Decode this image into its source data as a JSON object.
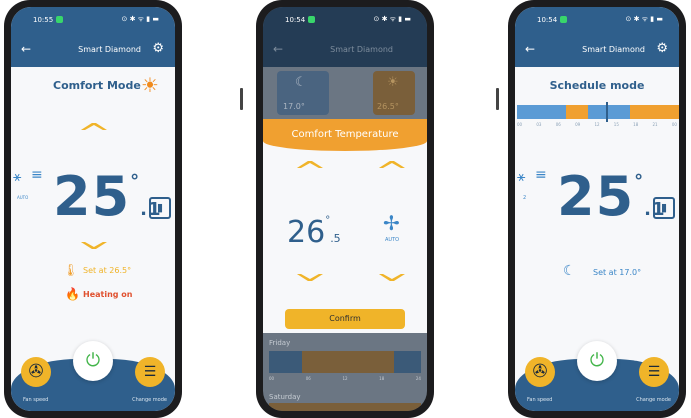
{
  "phone1": {
    "status": {
      "time": "10:55",
      "icons": "⊙ ✱ ᯤ ▮ ▬"
    },
    "header": {
      "back": "←",
      "title": "Smart Diamond"
    },
    "mode_title": "Comfort Mode",
    "fan_label": "AUTO",
    "temp_int": "25",
    "temp_dec": ".1",
    "temp_deg": "°",
    "set_text": "Set at 26.5°",
    "heating_text": "Heating on",
    "bottom": {
      "fan_speed": "Fan speed",
      "change_mode": "Change mode"
    }
  },
  "phone2": {
    "status": {
      "time": "10:54",
      "icons": "⊙ ✱ ᯤ ▮ ▬"
    },
    "header": {
      "back": "←",
      "title": "Smart Diamond"
    },
    "night_temp": "17.0°",
    "comfort_temp": "26.5°",
    "panel_title": "Comfort Temperature",
    "temp_int": "26",
    "temp_dec": ".5",
    "temp_deg": "°",
    "fan_label": "AUTO",
    "confirm_label": "Confirm",
    "day1": "Friday",
    "day2": "Saturday",
    "ticks": [
      "00",
      "06",
      "12",
      "18",
      "24"
    ]
  },
  "phone3": {
    "status": {
      "time": "10:54",
      "icons": "⊙ ✱ ᯤ ▮ ▬"
    },
    "header": {
      "back": "←",
      "title": "Smart Diamond"
    },
    "mode_title": "Schedule mode",
    "ticks": [
      "00",
      "03",
      "06",
      "09",
      "12",
      "15",
      "18",
      "21",
      "00"
    ],
    "fan_label": "2",
    "temp_int": "25",
    "temp_dec": ".1",
    "temp_deg": "°",
    "set_text": "Set at 17.0°",
    "bottom": {
      "fan_speed": "Fan speed",
      "change_mode": "Change mode"
    }
  },
  "colors": {
    "primary_blue": "#2f5f8c",
    "accent_orange": "#f0b429",
    "heating_red": "#e0512f"
  }
}
